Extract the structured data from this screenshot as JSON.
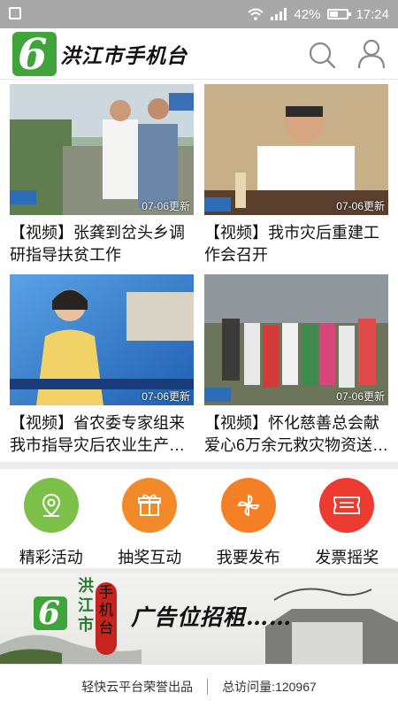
{
  "status_bar": {
    "battery": "42%",
    "time": "17:24"
  },
  "header": {
    "logo_mark": "6",
    "app_name": "洪江市手机台"
  },
  "news": [
    {
      "title": "【视频】张龚到岔头乡调研指导扶贫工作",
      "updated": "07-06更新"
    },
    {
      "title": "【视频】我市灾后重建工作会召开",
      "updated": "07-06更新"
    },
    {
      "title": "【视频】省农委专家组来我市指导灾后农业生产…",
      "updated": "07-06更新"
    },
    {
      "title": "【视频】怀化慈善总会献爱心6万余元救灾物资送…",
      "updated": "07-06更新"
    }
  ],
  "news_caption_strip": "省农委专家组来我市指导灾后农业生产工作",
  "actions": [
    {
      "label": "精彩活动",
      "icon": "location-pin-icon",
      "color": "#7cc04a"
    },
    {
      "label": "抽奖互动",
      "icon": "gift-box-icon",
      "color": "#f28a2a"
    },
    {
      "label": "我要发布",
      "icon": "pinwheel-icon",
      "color": "#f47f24"
    },
    {
      "label": "发票摇奖",
      "icon": "invoice-ticket-icon",
      "color": "#ee3b32"
    }
  ],
  "banner": {
    "vertical_text": "洪江市",
    "red_text": "手机台",
    "headline": "广告位招租……"
  },
  "footer": {
    "credit": "轻快云平台荣誉出品",
    "visits": "总访问量:120967"
  }
}
